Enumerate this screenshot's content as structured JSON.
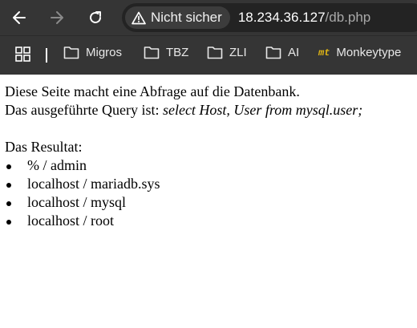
{
  "browser": {
    "security_label": "Nicht sicher",
    "url_host": "18.234.36.127",
    "url_path": "/db.php",
    "bookmarks": [
      {
        "label": "Migros",
        "icon": "folder-icon"
      },
      {
        "label": "TBZ",
        "icon": "folder-icon"
      },
      {
        "label": "ZLI",
        "icon": "folder-icon"
      },
      {
        "label": "AI",
        "icon": "folder-icon"
      },
      {
        "label": "Monkeytype",
        "icon": "monkeytype-logo",
        "logo_text": "mt"
      }
    ]
  },
  "page": {
    "intro_line": "Diese Seite macht eine Abfrage auf die Datenbank.",
    "query_prefix": "Das ausgeführte Query ist: ",
    "query": "select Host, User from mysql.user;",
    "result_heading": "Das Resultat:",
    "results": [
      "% / admin",
      "localhost / mariadb.sys",
      "localhost / mysql",
      "localhost / root"
    ]
  }
}
